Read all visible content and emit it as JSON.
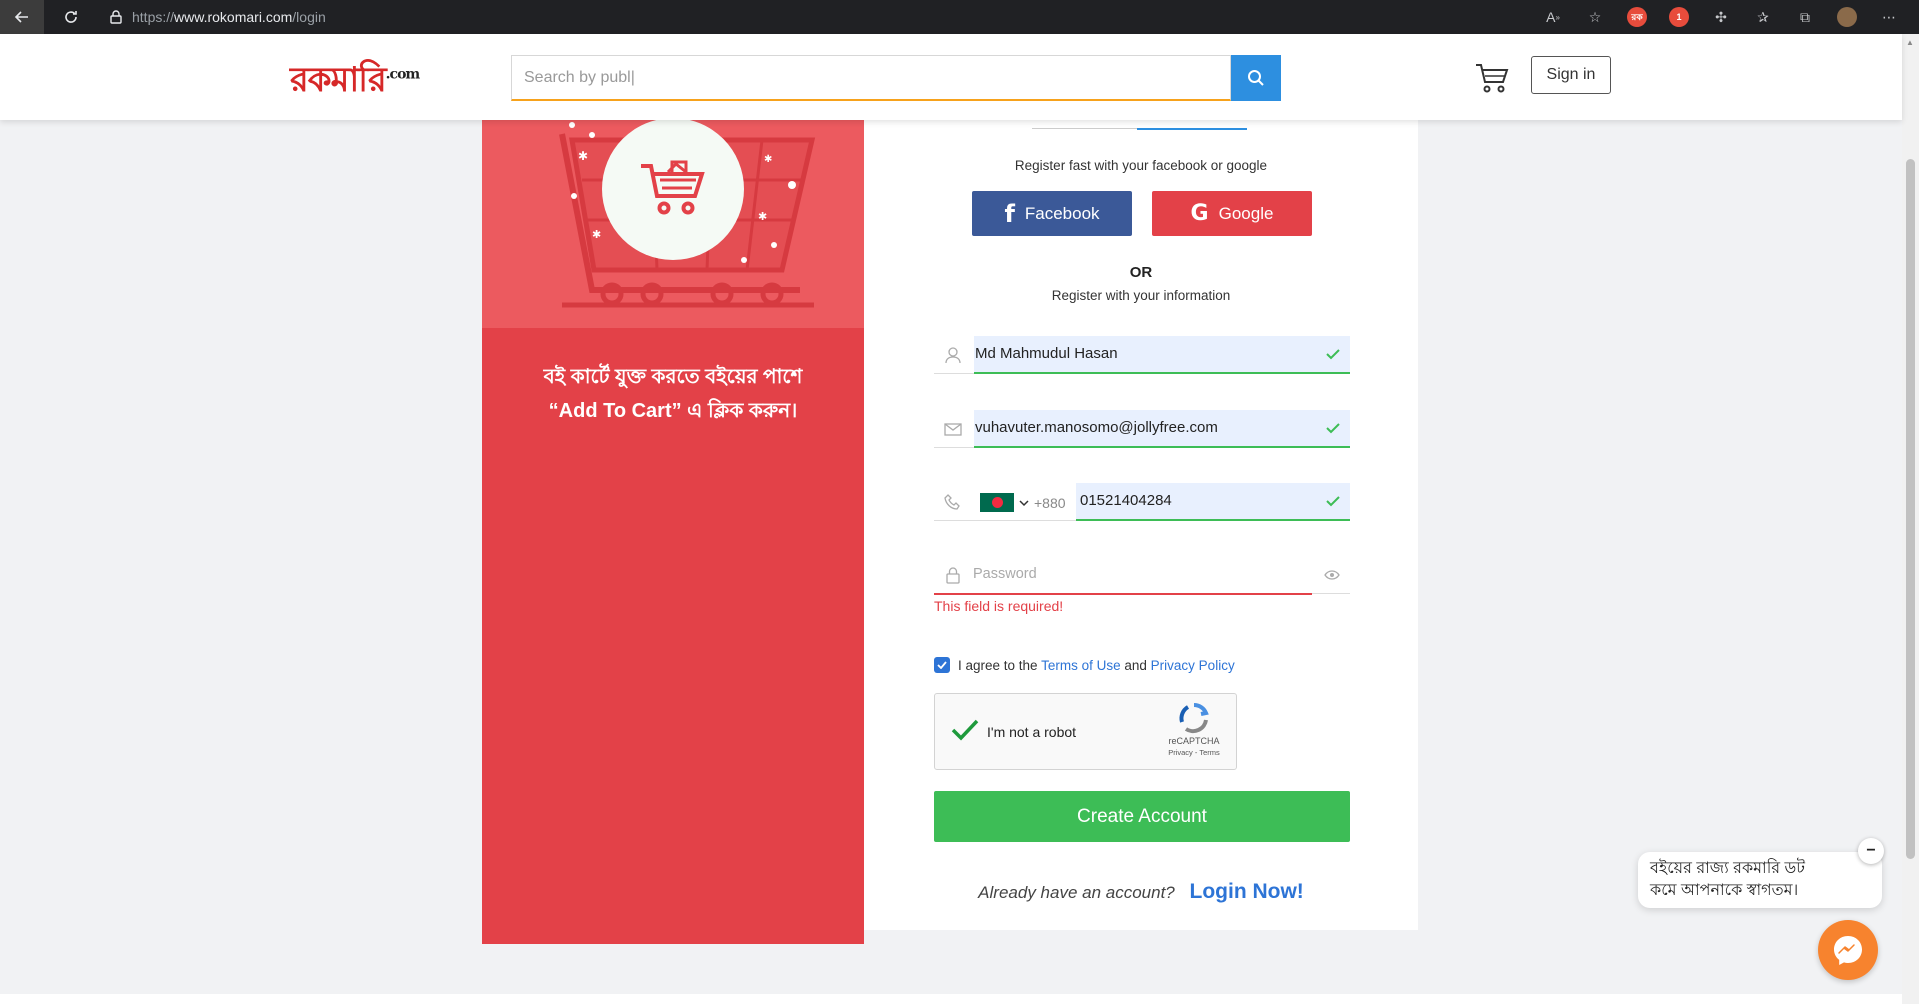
{
  "browser": {
    "url_scheme": "https://",
    "url_host": "www.rokomari.com",
    "url_path": "/login",
    "ext_badge": "1"
  },
  "header": {
    "logo_text": "রকমারি",
    "logo_suffix": ".com",
    "search_value": "Search by publ|",
    "signin_label": "Sign in"
  },
  "promo": {
    "line1": "বই কার্টে যুক্ত করতে বইয়ের পাশে",
    "line2": "“Add To Cart” এ ক্লিক করুন।"
  },
  "form": {
    "fast_text": "Register fast with your facebook or google",
    "facebook_label": "Facebook",
    "google_label": "Google",
    "or_text": "OR",
    "info_text": "Register with your information",
    "name_value": "Md Mahmudul Hasan",
    "email_value": "vuhavuter.manosomo@jollyfree.com",
    "phone_code": "+880",
    "phone_value": "01521404284",
    "password_placeholder": "Password",
    "password_error": "This field is required!",
    "agree_prefix": "I agree to the",
    "terms_link": "Terms of Use",
    "and_text": "and",
    "privacy_link": "Privacy Policy",
    "recaptcha_label": "I'm not a robot",
    "recaptcha_brand": "reCAPTCHA",
    "recaptcha_sub": "Privacy - Terms",
    "create_label": "Create Account",
    "already_text": "Already have an account?",
    "login_link": "Login Now!"
  },
  "chat": {
    "line1": "বইয়ের রাজ্য রকমারি ডট",
    "line2": "কমে আপনাকে স্বাগতম।",
    "close_glyph": "−"
  },
  "colors": {
    "brand_red": "#e34148",
    "facebook": "#3b5998",
    "success_green": "#3dbd56",
    "link_blue": "#2d74d6",
    "search_blue": "#2d8fe0",
    "search_accent": "#f7a21b",
    "messenger_orange": "#f7832e"
  }
}
